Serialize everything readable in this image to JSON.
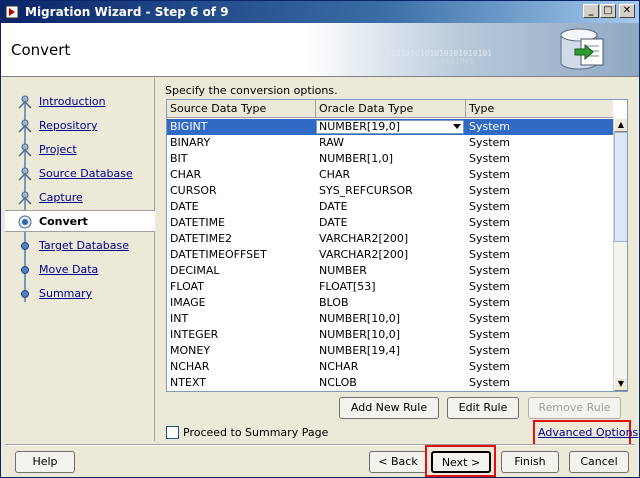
{
  "window": {
    "title": "Migration Wizard - Step 6 of 9"
  },
  "header": {
    "title": "Convert",
    "binary_deco_1": "0101010101010101010101",
    "binary_deco_2": "01010101001"
  },
  "steps": [
    {
      "label": "Introduction",
      "state": "done"
    },
    {
      "label": "Repository",
      "state": "done"
    },
    {
      "label": "Project",
      "state": "done"
    },
    {
      "label": "Source Database",
      "state": "done"
    },
    {
      "label": "Capture",
      "state": "done"
    },
    {
      "label": "Convert",
      "state": "current"
    },
    {
      "label": "Target Database",
      "state": "todo"
    },
    {
      "label": "Move Data",
      "state": "todo"
    },
    {
      "label": "Summary",
      "state": "todo"
    }
  ],
  "main": {
    "instructions": "Specify the conversion options.",
    "table": {
      "columns": [
        "Source Data Type",
        "Oracle Data Type",
        "Type"
      ],
      "rows": [
        {
          "source": "BIGINT",
          "oracle": "NUMBER[19,0]",
          "type": "System",
          "selected": true
        },
        {
          "source": "BINARY",
          "oracle": "RAW",
          "type": "System"
        },
        {
          "source": "BIT",
          "oracle": "NUMBER[1,0]",
          "type": "System"
        },
        {
          "source": "CHAR",
          "oracle": "CHAR",
          "type": "System"
        },
        {
          "source": "CURSOR",
          "oracle": "SYS_REFCURSOR",
          "type": "System"
        },
        {
          "source": "DATE",
          "oracle": "DATE",
          "type": "System"
        },
        {
          "source": "DATETIME",
          "oracle": "DATE",
          "type": "System"
        },
        {
          "source": "DATETIME2",
          "oracle": "VARCHAR2[200]",
          "type": "System"
        },
        {
          "source": "DATETIMEOFFSET",
          "oracle": "VARCHAR2[200]",
          "type": "System"
        },
        {
          "source": "DECIMAL",
          "oracle": "NUMBER",
          "type": "System"
        },
        {
          "source": "FLOAT",
          "oracle": "FLOAT[53]",
          "type": "System"
        },
        {
          "source": "IMAGE",
          "oracle": "BLOB",
          "type": "System"
        },
        {
          "source": "INT",
          "oracle": "NUMBER[10,0]",
          "type": "System"
        },
        {
          "source": "INTEGER",
          "oracle": "NUMBER[10,0]",
          "type": "System"
        },
        {
          "source": "MONEY",
          "oracle": "NUMBER[19,4]",
          "type": "System"
        },
        {
          "source": "NCHAR",
          "oracle": "NCHAR",
          "type": "System"
        },
        {
          "source": "NTEXT",
          "oracle": "NCLOB",
          "type": "System"
        }
      ]
    },
    "rule_buttons": {
      "add": "Add New Rule",
      "edit": "Edit Rule",
      "remove": "Remove Rule"
    },
    "proceed_checkbox": {
      "label": "Proceed to Summary Page",
      "checked": false
    },
    "advanced_link": "Advanced Options"
  },
  "footer": {
    "help": "Help",
    "back": "< Back",
    "next": "Next >",
    "finish": "Finish",
    "cancel": "Cancel"
  },
  "colors": {
    "selection": "#316ac5",
    "link": "#00008b",
    "highlight": "#e01010",
    "title_bar": "#0a246a"
  }
}
